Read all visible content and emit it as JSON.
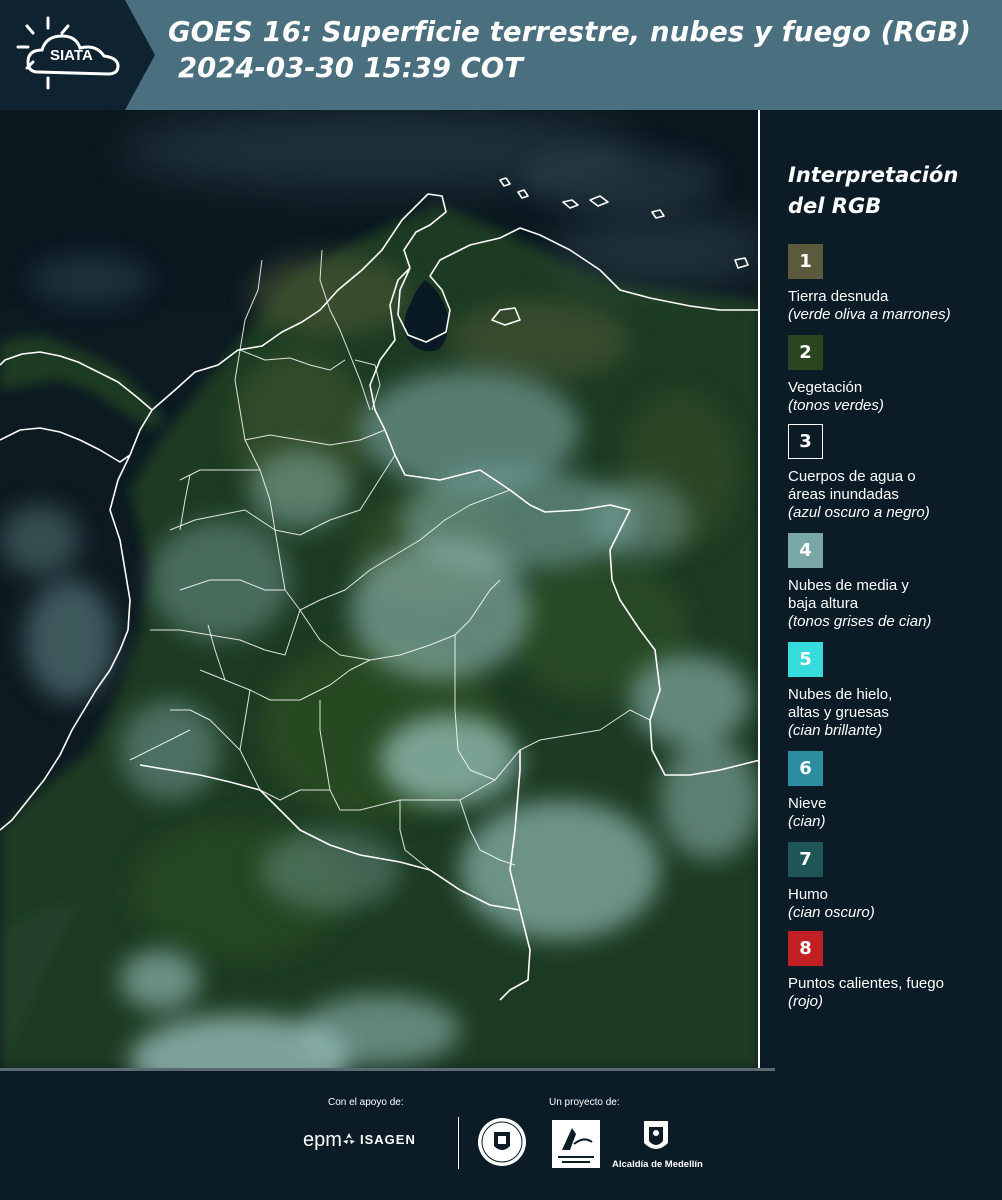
{
  "header": {
    "logo_text": "SIATA",
    "title": "GOES 16: Superficie terrestre, nubes y fuego (RGB)",
    "datetime": "2024-03-30 15:39 COT"
  },
  "legend": {
    "title_line1": "Interpretación",
    "title_line2": "del RGB",
    "items": [
      {
        "number": "1",
        "color": "#5b5a3c",
        "label": "Tierra desnuda",
        "note": "(verde oliva a marrones)"
      },
      {
        "number": "2",
        "color": "#2b4520",
        "label": "Vegetación",
        "note": "(tonos verdes)"
      },
      {
        "number": "3",
        "color": "#0b1c27",
        "label": "Cuerpos de agua o",
        "label2": "áreas inundadas",
        "note": "(azul oscuro a negro)"
      },
      {
        "number": "4",
        "color": "#7aa7a6",
        "label": "Nubes de media y",
        "label2": "baja altura",
        "note": "(tonos grises de cian)"
      },
      {
        "number": "5",
        "color": "#36dcdc",
        "label": "Nubes de hielo,",
        "label2": "altas y gruesas",
        "note": "(cian brillante)"
      },
      {
        "number": "6",
        "color": "#2a8ea0",
        "label": "Nieve",
        "note": "(cian)"
      },
      {
        "number": "7",
        "color": "#1e5658",
        "label": "Humo",
        "note": "(cian oscuro)"
      },
      {
        "number": "8",
        "color": "#c11f24",
        "label": "Puntos calientes, fuego",
        "note": "(rojo)"
      }
    ]
  },
  "footer": {
    "support_label": "Con el apoyo de:",
    "project_label": "Un proyecto de:",
    "sponsors": [
      "epm",
      "ISAGEN"
    ],
    "alcaldia": "Alcaldía de Medellín"
  }
}
